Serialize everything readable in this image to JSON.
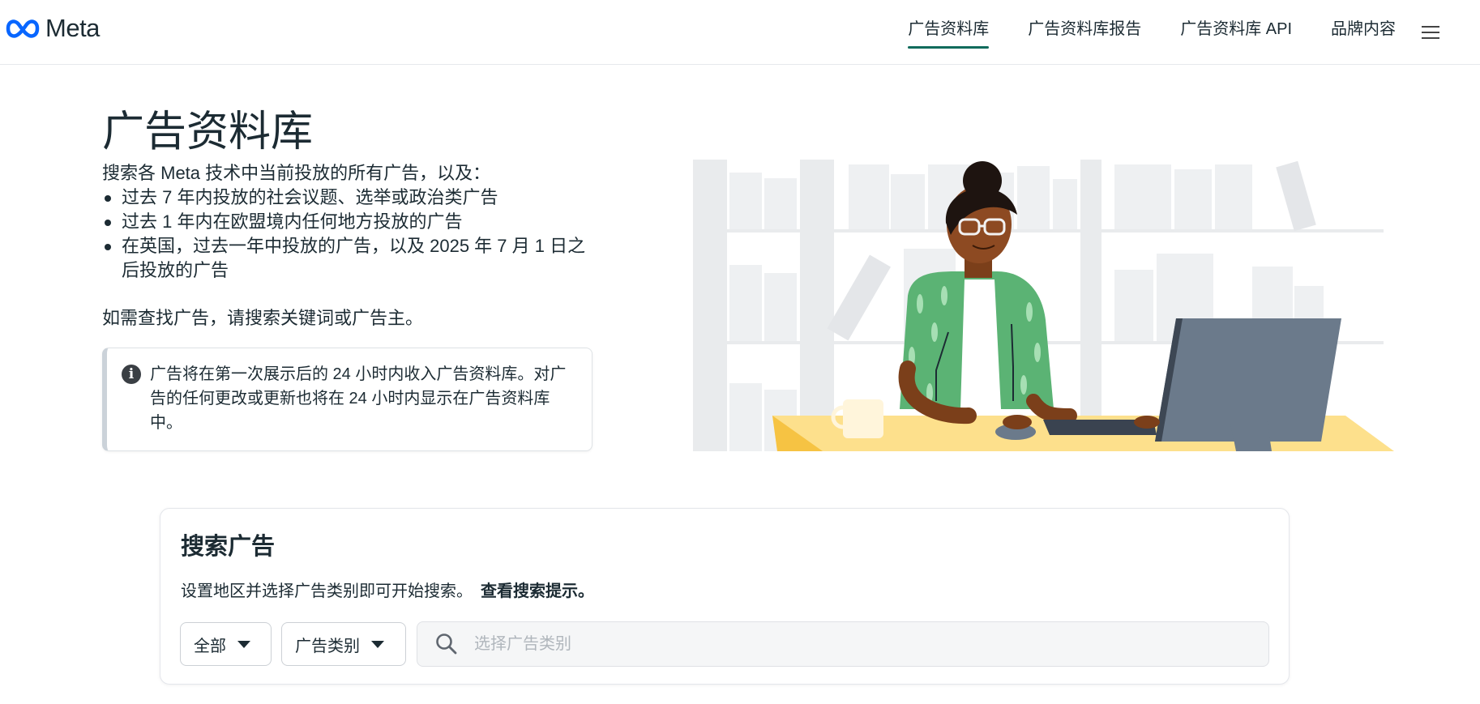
{
  "header": {
    "logo_text": "Meta",
    "nav": [
      {
        "label": "广告资料库",
        "active": true
      },
      {
        "label": "广告资料库报告",
        "active": false
      },
      {
        "label": "广告资料库 API",
        "active": false
      },
      {
        "label": "品牌内容",
        "active": false
      }
    ],
    "menu_icon": "hamburger-menu-icon"
  },
  "intro": {
    "title": "广告资料库",
    "lead": "搜索各 Meta 技术中当前投放的所有广告，以及：",
    "bullets": [
      "过去 7 年内投放的社会议题、选举或政治类广告",
      "过去 1 年内在欧盟境内任何地方投放的广告",
      "在英国，过去一年中投放的广告，以及 2025 年 7 月 1 日之后投放的广告"
    ],
    "search_hint": "如需查找广告，请搜索关键词或广告主。",
    "notice": "广告将在第一次展示后的 24 小时内收入广告资料库。对广告的任何更改或更新也将在 24 小时内显示在广告资料库中。",
    "notice_icon": "info-icon"
  },
  "search": {
    "title": "搜索广告",
    "subtitle": "设置地区并选择广告类别即可开始搜索。",
    "tips_link": "查看搜索提示。",
    "region_selected": "全部",
    "category_selected": "广告类别",
    "input_placeholder": "选择广告类别",
    "input_value": ""
  },
  "colors": {
    "accent": "#0f6b5c",
    "text": "#1c2b33",
    "meta_blue": "#0866ff",
    "sweater_green": "#5bb374",
    "desk_yellow": "#fde08c",
    "monitor_gray": "#6b7a8b"
  }
}
